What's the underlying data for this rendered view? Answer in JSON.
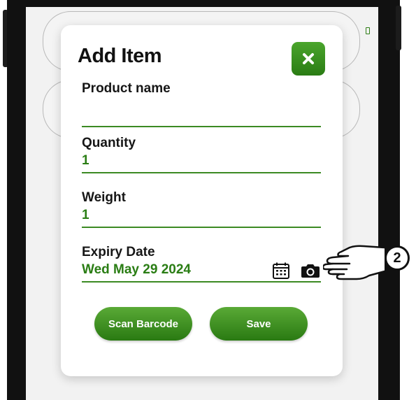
{
  "modal": {
    "title": "Add Item",
    "close_icon": "close-x-icon"
  },
  "fields": {
    "product_name": {
      "label": "Product name",
      "value": ""
    },
    "quantity": {
      "label": "Quantity",
      "value": "1"
    },
    "weight": {
      "label": "Weight",
      "value": "1"
    },
    "expiry_date": {
      "label": "Expiry Date",
      "value": "Wed May 29 2024"
    }
  },
  "icons": {
    "calendar": "calendar-icon",
    "camera": "camera-icon",
    "pointer": "hand-pointer-icon"
  },
  "buttons": {
    "scan_barcode": "Scan Barcode",
    "save": "Save"
  },
  "annotation": {
    "step_number": "2"
  },
  "colors": {
    "accent_green": "#2a7d14",
    "button_gradient_top": "#5aaa36",
    "button_gradient_bottom": "#2a7a12",
    "screen_background": "#f2f2f2",
    "modal_background": "#ffffff"
  }
}
